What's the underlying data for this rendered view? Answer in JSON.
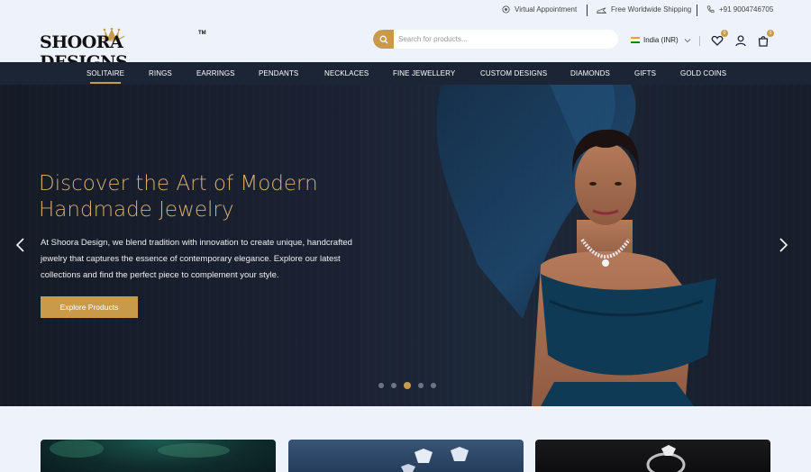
{
  "topbar": {
    "virtual_appointment": "Virtual Appointment",
    "free_shipping": "Free Worldwide Shipping",
    "phone": "+91 9004746705"
  },
  "logo": {
    "text": "SHOORA DESIGNS",
    "tm": "TM"
  },
  "search": {
    "placeholder": "Search for products..."
  },
  "country": {
    "label": "India (INR)"
  },
  "wishlist": {
    "count": "0"
  },
  "cart": {
    "count": "0"
  },
  "nav": {
    "items": [
      "SOLITAIRE",
      "RINGS",
      "EARRINGS",
      "PENDANTS",
      "NECKLACES",
      "FINE JEWELLERY",
      "CUSTOM DESIGNS",
      "DIAMONDS",
      "GIFTS",
      "GOLD COINS"
    ],
    "active": "SOLITAIRE"
  },
  "hero": {
    "title": "Discover the Art of Modern Handmade Jewelry",
    "text": "At Shoora Design, we blend tradition with innovation to create unique, handcrafted jewelry that captures the essence of contemporary elegance. Explore our latest collections and find the perfect piece to complement your style.",
    "cta": "Explore Products",
    "slide_count": 5,
    "active_slide": 3
  },
  "colors": {
    "accent": "#c99a4a",
    "nav_bg": "#1c2535",
    "hero_title": "#d7ae6e"
  }
}
